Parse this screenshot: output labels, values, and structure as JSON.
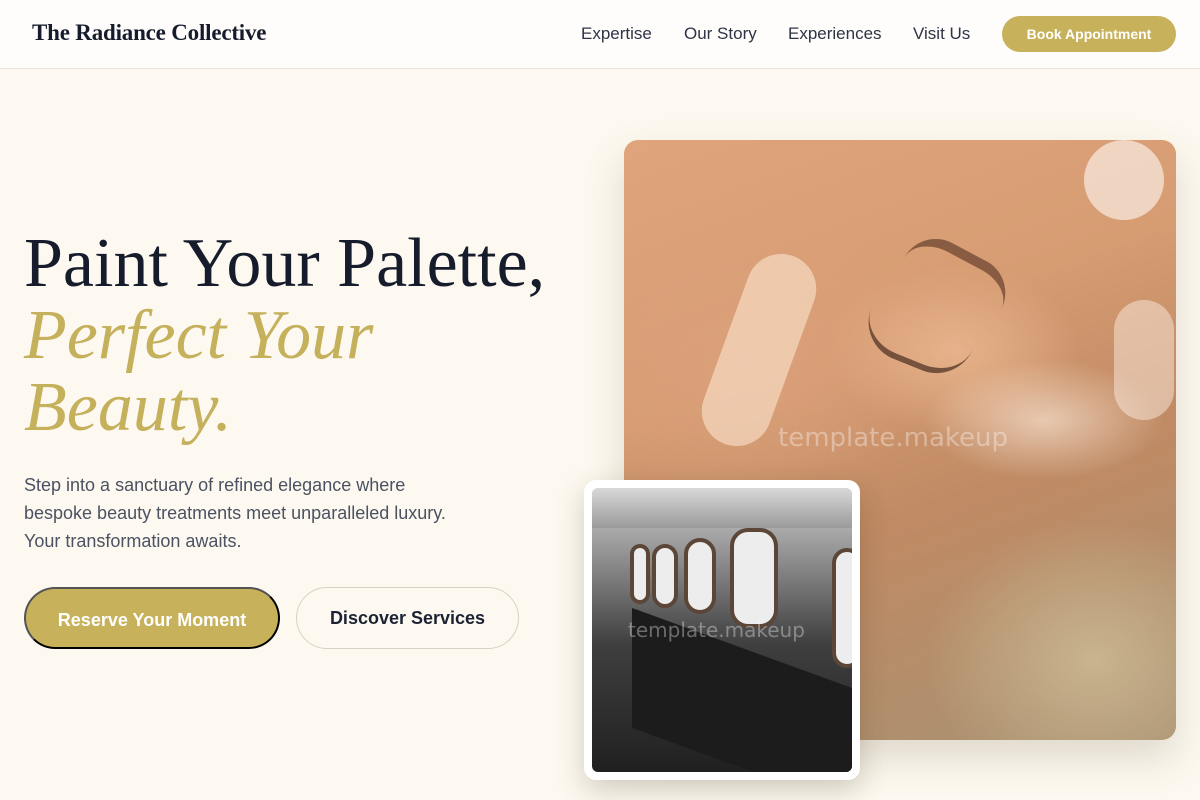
{
  "header": {
    "logo": "The Radiance Collective",
    "nav": [
      "Expertise",
      "Our Story",
      "Experiences",
      "Visit Us"
    ],
    "cta": "Book Appointment"
  },
  "hero": {
    "headline_line1": "Paint Your Palette,",
    "headline_accent_line1": "Perfect Your",
    "headline_accent_line2": "Beauty.",
    "lead": "Step into a sanctuary of refined elegance where bespoke beauty treatments meet unparalleled luxury. Your transformation awaits.",
    "primary_button": "Reserve Your Moment",
    "secondary_button": "Discover Services"
  },
  "images": {
    "main_watermark": "template.makeup",
    "inset_watermark": "template.makeup"
  },
  "colors": {
    "accent": "#c7b25b",
    "background": "#fdf9f0",
    "heading": "#161c2c"
  }
}
